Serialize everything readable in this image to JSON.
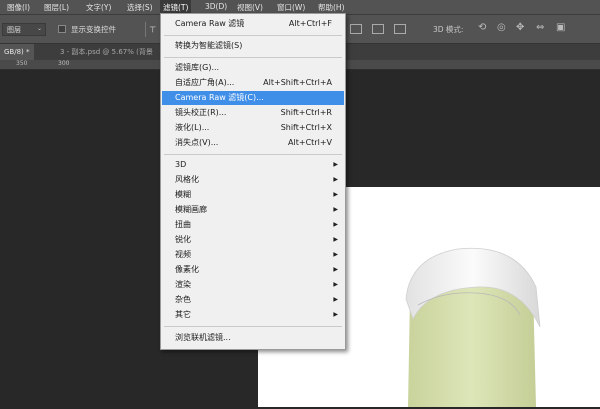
{
  "menubar": {
    "items": [
      "图像(I)",
      "图层(L)",
      "文字(Y)",
      "选择(S)",
      "滤镜(T)",
      "3D(D)",
      "视图(V)",
      "窗口(W)",
      "帮助(H)"
    ]
  },
  "options": {
    "layer_select": "图层",
    "show_transform": "显示变换控件",
    "mode_3d": "3D 模式:"
  },
  "tabs": {
    "t1": "GB/8) *",
    "t2": "3 - 副本.psd @ 5.67% (背景"
  },
  "ruler": [
    "350",
    "300"
  ],
  "filter_menu": {
    "items": [
      {
        "label": "Camera Raw 滤镜",
        "shortcut": "Alt+Ctrl+F"
      },
      {
        "label": "转换为智能滤镜(S)"
      },
      {
        "label": "滤镜库(G)..."
      },
      {
        "label": "自适应广角(A)...",
        "shortcut": "Alt+Shift+Ctrl+A"
      },
      {
        "label": "Camera Raw 滤镜(C)...",
        "highlighted": true
      },
      {
        "label": "镜头校正(R)...",
        "shortcut": "Shift+Ctrl+R"
      },
      {
        "label": "液化(L)...",
        "shortcut": "Shift+Ctrl+X"
      },
      {
        "label": "消失点(V)...",
        "shortcut": "Alt+Ctrl+V"
      },
      {
        "label": "3D",
        "submenu": true
      },
      {
        "label": "风格化",
        "submenu": true
      },
      {
        "label": "模糊",
        "submenu": true
      },
      {
        "label": "模糊画廊",
        "submenu": true
      },
      {
        "label": "扭曲",
        "submenu": true
      },
      {
        "label": "锐化",
        "submenu": true
      },
      {
        "label": "视频",
        "submenu": true
      },
      {
        "label": "像素化",
        "submenu": true
      },
      {
        "label": "渲染",
        "submenu": true
      },
      {
        "label": "杂色",
        "submenu": true
      },
      {
        "label": "其它",
        "submenu": true
      },
      {
        "label": "浏览联机滤镜..."
      }
    ]
  },
  "colors": {
    "highlight": "#3f8ee8",
    "product_green": "#d6dfb0",
    "cap_white": "#f4f4f4"
  }
}
